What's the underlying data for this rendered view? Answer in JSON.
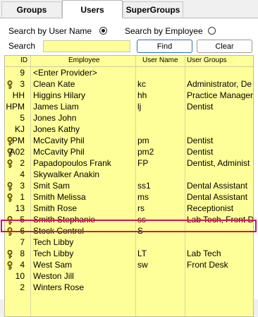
{
  "tabs": [
    "Groups",
    "Users",
    "SuperGroups"
  ],
  "search": {
    "by_user_name_label": "Search by User Name",
    "by_employee_label": "Search by Employee",
    "search_label": "Search",
    "search_value": "",
    "find_label": "Find",
    "clear_label": "Clear"
  },
  "columns": [
    "ID",
    "Employee",
    "User Name",
    "User Groups"
  ],
  "rows": [
    {
      "key": false,
      "id": "9",
      "employee": "<Enter Provider>",
      "user": "",
      "groups": ""
    },
    {
      "key": true,
      "id": "3",
      "employee": "Clean Kate",
      "user": "kc",
      "groups": "Administrator, De"
    },
    {
      "key": false,
      "id": "HH",
      "employee": "Higgins Hilary",
      "user": "hh",
      "groups": "Practice Manager"
    },
    {
      "key": false,
      "id": "HPM",
      "employee": "James Liam",
      "user": "lj",
      "groups": "Dentist"
    },
    {
      "key": false,
      "id": "5",
      "employee": "Jones John",
      "user": "",
      "groups": ""
    },
    {
      "key": false,
      "id": "KJ",
      "employee": "Jones Kathy",
      "user": "",
      "groups": ""
    },
    {
      "key": true,
      "id": "PM",
      "employee": "McCavity Phil",
      "user": "pm",
      "groups": "Dentist"
    },
    {
      "key": true,
      "id": "A02",
      "employee": "McCavity Phil",
      "user": "pm2",
      "groups": "Dentist"
    },
    {
      "key": true,
      "id": "2",
      "employee": "Papadopoulos Frank",
      "user": "FP",
      "groups": "Dentist, Administ"
    },
    {
      "key": false,
      "id": "4",
      "employee": "Skywalker Anakin",
      "user": "",
      "groups": ""
    },
    {
      "key": true,
      "id": "3",
      "employee": "Smit Sam",
      "user": "ss1",
      "groups": "Dental Assistant"
    },
    {
      "key": true,
      "id": "1",
      "employee": "Smith Melissa",
      "user": "ms",
      "groups": "Dental Assistant"
    },
    {
      "key": false,
      "id": "13",
      "employee": "Smith Rose",
      "user": "rs",
      "groups": "Receptionist"
    },
    {
      "key": true,
      "id": "5",
      "employee": "Smith Stephanie",
      "user": "ss",
      "groups": "Lab Tech, Front D"
    },
    {
      "key": true,
      "id": "6",
      "employee": "Stock  Control",
      "user": "S",
      "groups": ""
    },
    {
      "key": false,
      "id": "7",
      "employee": "Tech Libby",
      "user": "",
      "groups": ""
    },
    {
      "key": true,
      "id": "8",
      "employee": "Tech Libby",
      "user": "LT",
      "groups": "Lab Tech"
    },
    {
      "key": true,
      "id": "4",
      "employee": "West Sam",
      "user": "sw",
      "groups": "Front Desk"
    },
    {
      "key": false,
      "id": "10",
      "employee": "Weston Jill",
      "user": "",
      "groups": ""
    },
    {
      "key": false,
      "id": "2",
      "employee": "Winters Rose",
      "user": "",
      "groups": ""
    }
  ],
  "colors": {
    "grid_bg": "#ffff99",
    "highlight_border": "#d0145a",
    "button_border": "#2c6fbf"
  },
  "icons": {
    "key": "key-icon"
  }
}
